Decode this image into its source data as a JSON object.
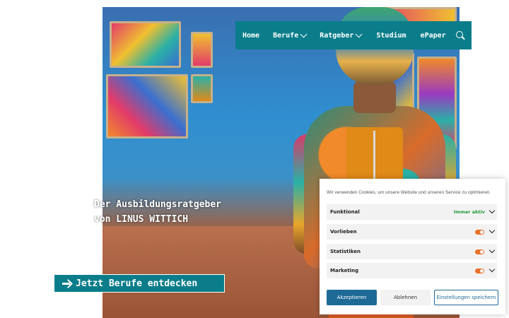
{
  "nav": {
    "items": [
      {
        "label": "Home",
        "has_dropdown": false
      },
      {
        "label": "Berufe",
        "has_dropdown": true
      },
      {
        "label": "Ratgeber",
        "has_dropdown": true
      },
      {
        "label": "Studium",
        "has_dropdown": false
      },
      {
        "label": "ePaper",
        "has_dropdown": false
      }
    ],
    "search_icon": "search-icon",
    "color": "#0b7d8a"
  },
  "hero": {
    "title_line1": "Der Ausbildungsratgeber",
    "title_line2": "von LINUS WITTICH",
    "cta_label": "Jetzt Berufe entdecken",
    "cta_icon": "arrow-right-icon"
  },
  "cookie": {
    "text": "Wir verwenden Cookies, um unsere Website und unseren Service zu optimieren.",
    "categories": [
      {
        "label": "Funktional",
        "status": "Immer aktiv"
      },
      {
        "label": "Vorlieben",
        "toggle": "on"
      },
      {
        "label": "Statistiken",
        "toggle": "on"
      },
      {
        "label": "Marketing",
        "toggle": "on"
      }
    ],
    "buttons": {
      "accept": "Akzeptieren",
      "reject": "Ablehnen",
      "save": "Einstellungen speichern"
    },
    "accent_color": "#1e6a96",
    "toggle_color": "#e8702a",
    "status_color": "#1f9a3a"
  }
}
